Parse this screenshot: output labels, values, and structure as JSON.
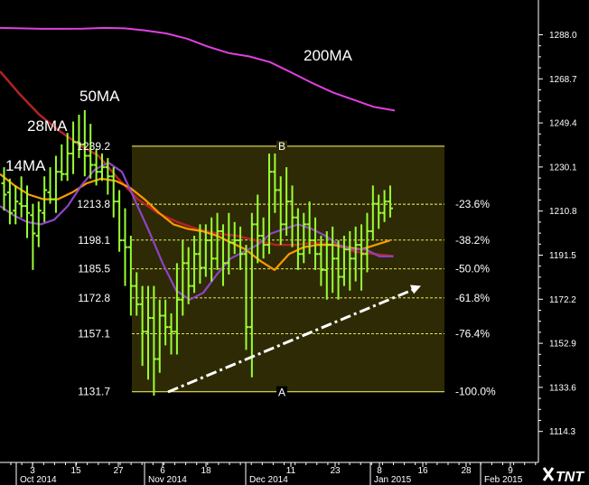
{
  "colors": {
    "background": "#000000",
    "zone_fill": "#2d2a05",
    "fib_line": "#ffff66",
    "bars": "#99ff33",
    "ma_14": "#8e44c8",
    "ma_28": "#ff9900",
    "ma_50": "#b22222",
    "ma_200": "#e040e0",
    "trendline": "#ffffff"
  },
  "logo": {
    "text": "TNT"
  },
  "chart_data": {
    "type": "bar",
    "y_axis": {
      "ticks": [
        "1288.0",
        "1268.7",
        "1249.4",
        "1230.1",
        "1210.8",
        "1191.5",
        "1172.2",
        "1152.9",
        "1133.6",
        "1114.3"
      ],
      "tick_values": [
        1288.0,
        1268.7,
        1249.4,
        1230.1,
        1210.8,
        1191.5,
        1172.2,
        1152.9,
        1133.6,
        1114.3
      ],
      "ylim": [
        1096,
        1304
      ]
    },
    "x_axis": {
      "day_ticks": [
        "3",
        "15",
        "27",
        "6",
        "18",
        "11",
        "23",
        "8",
        "16",
        "28",
        "9"
      ],
      "month_labels": [
        "Oct 2014",
        "Nov 2014",
        "Dec 2014",
        "Jan 2015",
        "Feb 2015"
      ]
    },
    "ma_labels": [
      "14MA",
      "28MA",
      "50MA",
      "200MA"
    ],
    "fib_retracement": {
      "high_label": "B",
      "low_label": "A",
      "levels": [
        {
          "price": "1239.2",
          "pct": ""
        },
        {
          "price": "1213.8",
          "pct": "-23.6%"
        },
        {
          "price": "1198.1",
          "pct": "-38.2%"
        },
        {
          "price": "1185.5",
          "pct": "-50.0%"
        },
        {
          "price": "1172.8",
          "pct": "-61.8%"
        },
        {
          "price": "1157.1",
          "pct": "-76.4%"
        },
        {
          "price": "1131.7",
          "pct": "-100.0%"
        }
      ],
      "values": [
        1239.2,
        1213.8,
        1198.1,
        1185.5,
        1172.8,
        1157.1,
        1131.7
      ]
    },
    "ohlc_bars": [
      [
        1223,
        1218,
        1230,
        1211
      ],
      [
        1219,
        1210,
        1225,
        1205
      ],
      [
        1211,
        1215,
        1222,
        1205
      ],
      [
        1214,
        1213,
        1226,
        1208
      ],
      [
        1213,
        1210,
        1222,
        1199
      ],
      [
        1209,
        1201,
        1214,
        1185
      ],
      [
        1200,
        1211,
        1215,
        1195
      ],
      [
        1210,
        1220,
        1226,
        1206
      ],
      [
        1219,
        1216,
        1230,
        1214
      ],
      [
        1216,
        1228,
        1235,
        1210
      ],
      [
        1228,
        1227,
        1240,
        1224
      ],
      [
        1227,
        1236,
        1245,
        1224
      ],
      [
        1236,
        1241,
        1250,
        1227
      ],
      [
        1241,
        1240,
        1253,
        1234
      ],
      [
        1240,
        1235,
        1255,
        1226
      ],
      [
        1235,
        1231,
        1249,
        1225
      ],
      [
        1231,
        1228,
        1238,
        1222
      ],
      [
        1228,
        1230,
        1236,
        1224
      ],
      [
        1230,
        1226,
        1234,
        1218
      ],
      [
        1226,
        1215,
        1230,
        1208
      ],
      [
        1215,
        1198,
        1220,
        1193
      ],
      [
        1198,
        1195,
        1212,
        1178
      ],
      [
        1195,
        1178,
        1200,
        1165
      ],
      [
        1178,
        1170,
        1184,
        1165
      ],
      [
        1170,
        1158,
        1178,
        1143
      ],
      [
        1158,
        1164,
        1178,
        1137
      ],
      [
        1164,
        1146,
        1178,
        1130
      ],
      [
        1146,
        1165,
        1172,
        1140
      ],
      [
        1165,
        1160,
        1172,
        1152
      ],
      [
        1160,
        1158,
        1166,
        1148
      ],
      [
        1158,
        1172,
        1188,
        1148
      ],
      [
        1172,
        1188,
        1198,
        1165
      ],
      [
        1188,
        1178,
        1195,
        1170
      ],
      [
        1178,
        1192,
        1200,
        1175
      ],
      [
        1192,
        1186,
        1205,
        1179
      ],
      [
        1186,
        1198,
        1205,
        1182
      ],
      [
        1198,
        1190,
        1208,
        1180
      ],
      [
        1190,
        1202,
        1210,
        1185
      ],
      [
        1202,
        1188,
        1205,
        1178
      ],
      [
        1188,
        1197,
        1210,
        1183
      ],
      [
        1197,
        1198,
        1206,
        1192
      ],
      [
        1198,
        1192,
        1204,
        1185
      ],
      [
        1192,
        1160,
        1196,
        1150
      ],
      [
        1160,
        1205,
        1210,
        1138
      ],
      [
        1205,
        1200,
        1218,
        1188
      ],
      [
        1200,
        1196,
        1208,
        1190
      ],
      [
        1196,
        1228,
        1236,
        1192
      ],
      [
        1228,
        1220,
        1236,
        1210
      ],
      [
        1220,
        1205,
        1226,
        1196
      ],
      [
        1205,
        1215,
        1230,
        1200
      ],
      [
        1215,
        1208,
        1222,
        1195
      ],
      [
        1208,
        1192,
        1212,
        1185
      ],
      [
        1192,
        1205,
        1210,
        1188
      ],
      [
        1205,
        1198,
        1215,
        1192
      ],
      [
        1198,
        1192,
        1208,
        1185
      ],
      [
        1192,
        1185,
        1200,
        1178
      ],
      [
        1185,
        1196,
        1202,
        1172
      ],
      [
        1196,
        1190,
        1204,
        1175
      ],
      [
        1190,
        1182,
        1198,
        1172
      ],
      [
        1182,
        1194,
        1200,
        1178
      ],
      [
        1194,
        1190,
        1202,
        1176
      ],
      [
        1190,
        1196,
        1204,
        1180
      ],
      [
        1196,
        1192,
        1205,
        1176
      ],
      [
        1192,
        1202,
        1210,
        1184
      ],
      [
        1202,
        1214,
        1222,
        1198
      ],
      [
        1214,
        1210,
        1218,
        1203
      ],
      [
        1210,
        1215,
        1220,
        1206
      ],
      [
        1215,
        1212,
        1222,
        1208
      ]
    ],
    "moving_averages": {
      "ma_14": [
        1213,
        1209,
        1206,
        1205,
        1207,
        1213,
        1222,
        1229,
        1232,
        1228,
        1215,
        1202,
        1188,
        1176,
        1172,
        1175,
        1183,
        1190,
        1193,
        1196,
        1201,
        1203,
        1205,
        1203,
        1200,
        1196,
        1194,
        1194,
        1191,
        1191
      ],
      "ma_28": [
        1227,
        1222,
        1218,
        1216,
        1216,
        1219,
        1223,
        1225,
        1224,
        1221,
        1216,
        1210,
        1205,
        1203,
        1202,
        1200,
        1197,
        1194,
        1189,
        1185,
        1192,
        1195,
        1196,
        1196,
        1195,
        1194,
        1196,
        1198
      ],
      "ma_50": [
        1272,
        1262,
        1253,
        1246,
        1240,
        1235,
        1225,
        1216,
        1210,
        1206,
        1203,
        1201,
        1200,
        1198,
        1196,
        1196,
        1197,
        1196,
        1193,
        1192,
        1191
      ],
      "ma_200": [
        1291.0,
        1290.8,
        1290.6,
        1290.6,
        1290.7,
        1291.0,
        1290.8,
        1289.9,
        1288.6,
        1286.3,
        1282.8,
        1280.0,
        1278.5,
        1276.0,
        1271.6,
        1267.0,
        1262.8,
        1259.6,
        1256.4,
        1254.8
      ]
    },
    "trendline": {
      "from": [
        1130,
        1130
      ],
      "to": [
        1182,
        1182
      ]
    }
  }
}
